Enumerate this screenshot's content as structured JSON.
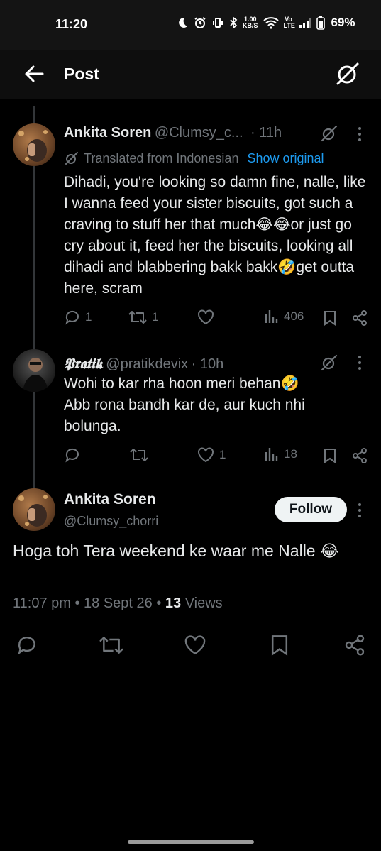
{
  "status_bar": {
    "time": "11:20",
    "net_speed_top": "1.00",
    "net_speed_bottom": "KB/S",
    "volte": "Vo LTE",
    "battery": "69%"
  },
  "header": {
    "title": "Post"
  },
  "parent_tweet": {
    "name": "Ankita Soren",
    "handle": "@Clumsy_c...",
    "time": "· 11h",
    "translated_label": "Translated from Indonesian",
    "show_original": "Show original",
    "text": "Dihadi, you're looking so damn fine, nalle, like I wanna feed your sister biscuits, got such a craving to stuff her that much😂😂or just go cry about it, feed her the biscuits, looking all dihadi and blabbering bakk bakk🤣get outta here, scram",
    "replies": "1",
    "reposts": "1",
    "likes": "",
    "views": "406"
  },
  "reply_tweet": {
    "name": "𝕻𝖗𝖆𝖙𝖎𝖐",
    "handle": "@pratikdevix",
    "time": "· 10h",
    "text": "Wohi to kar rha hoon meri behan🤣\nAbb rona bandh kar de, aur kuch nhi bolunga.",
    "replies": "",
    "reposts": "",
    "likes": "1",
    "views": "18"
  },
  "main_tweet": {
    "name": "Ankita Soren",
    "handle": "@Clumsy_chorri",
    "follow_label": "Follow",
    "text": "Hoga toh Tera weekend ke waar me Nalle 😂",
    "timestamp": "11:07 pm • 18 Sept 26 • ",
    "views_count": "13",
    "views_label": " Views"
  },
  "colors": {
    "background": "#000000",
    "text": "#e7e9ea",
    "muted": "#71767b",
    "link": "#1d9bf0"
  }
}
